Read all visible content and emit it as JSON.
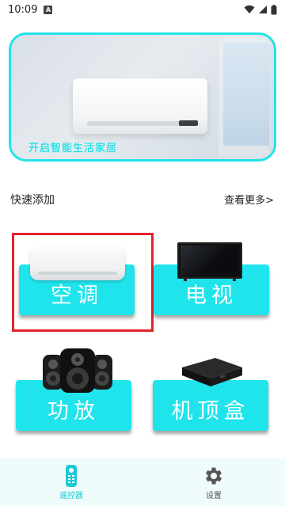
{
  "status_bar": {
    "time": "10:09",
    "notification_glyph": "A"
  },
  "banner": {
    "caption": "开启智能生活家居"
  },
  "section": {
    "title": "快速添加",
    "see_more": "查看更多>"
  },
  "devices": [
    {
      "label": "空调",
      "icon": "air-conditioner-icon",
      "selected": true
    },
    {
      "label": "电视",
      "icon": "tv-icon",
      "selected": false
    },
    {
      "label": "功放",
      "icon": "speaker-icon",
      "selected": false
    },
    {
      "label": "机顶盒",
      "icon": "set-top-box-icon",
      "selected": false
    }
  ],
  "bottom_nav": [
    {
      "label": "遥控器",
      "icon": "remote-control-icon",
      "active": true
    },
    {
      "label": "设置",
      "icon": "gear-icon",
      "active": false
    }
  ],
  "colors": {
    "accent": "#1fe4ec",
    "selection": "#e3232b",
    "nav_active": "#1cc9d2",
    "nav_bg": "#f0fbfb"
  }
}
